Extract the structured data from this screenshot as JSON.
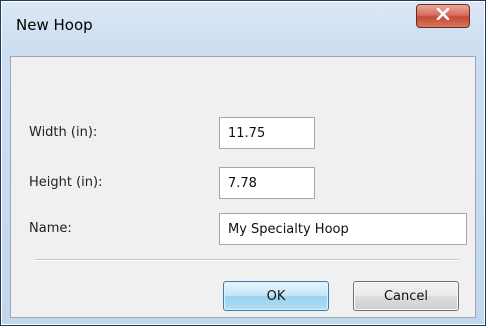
{
  "window": {
    "title": "New Hoop"
  },
  "fields": {
    "width": {
      "label": "Width (in):",
      "value": "11.75"
    },
    "height": {
      "label": "Height (in):",
      "value": "7.78"
    },
    "name": {
      "label": "Name:",
      "value": "My Specialty Hoop"
    }
  },
  "buttons": {
    "ok_label": "OK",
    "cancel_label": "Cancel"
  },
  "icons": {
    "close": "close-icon"
  },
  "colors": {
    "close_button": "#c24a35",
    "ok_button_accent": "#3c7fb1"
  }
}
